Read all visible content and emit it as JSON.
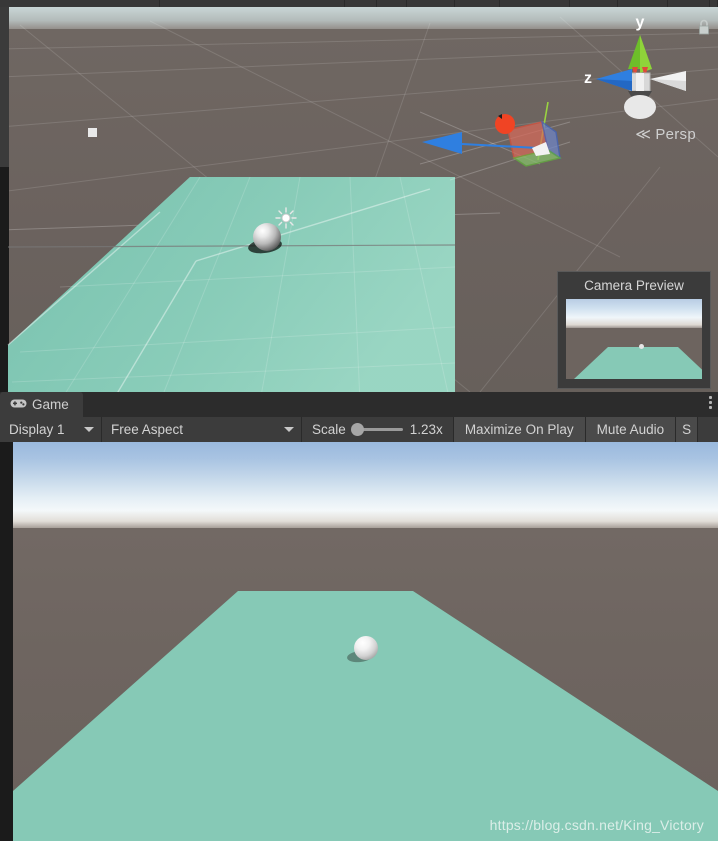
{
  "scene_view": {
    "gizmo": {
      "axis_y_label": "y",
      "axis_z_label": "z",
      "projection_label": "Persp",
      "projection_prefix": "≪"
    },
    "camera_preview": {
      "title": "Camera Preview"
    },
    "colors": {
      "ground": "#6d6460",
      "sky": "#b9c2c1",
      "plane": "#7cc8b5",
      "axis_x": "#e04a3a",
      "axis_y": "#8fd43a",
      "axis_z": "#2f7fe0"
    }
  },
  "game_panel": {
    "tab": {
      "label": "Game",
      "icon": "gamepad-icon"
    },
    "menu_icon": "kebab-menu-icon",
    "toolbar": {
      "display": {
        "value": "Display 1",
        "caret": "chevron-down-icon"
      },
      "aspect": {
        "value": "Free Aspect",
        "caret": "chevron-down-icon"
      },
      "scale": {
        "label": "Scale",
        "value": "1.23x",
        "slider_percent": 6
      },
      "maximize_on_play": "Maximize On Play",
      "mute_audio": "Mute Audio",
      "stats_truncated": "S"
    },
    "watermark": "https://blog.csdn.net/King_Victory",
    "colors": {
      "panel_bg": "#393939",
      "toolbar_bg": "#3c3c3c",
      "button_bg": "#4a4a4a",
      "text": "#d2d2d2",
      "game_plane": "#86c9b6",
      "game_ground": "#6e6560"
    }
  }
}
